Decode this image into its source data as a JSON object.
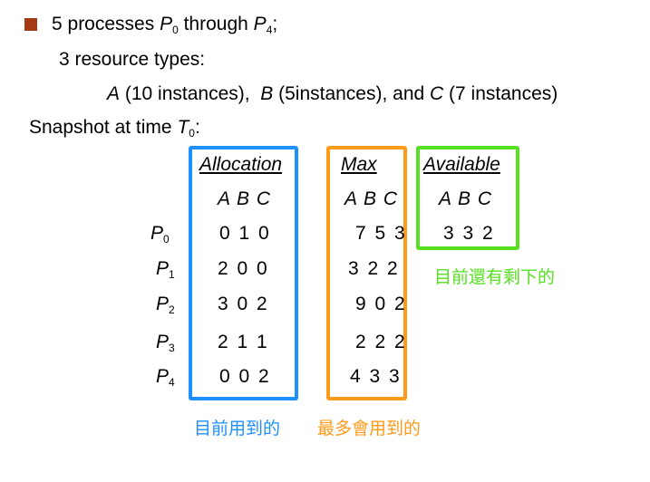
{
  "colors": {
    "bullet": "#a33a13",
    "allocation": "#1e90ff",
    "max": "#ff9a1a",
    "available": "#55e020"
  },
  "line1": {
    "prefix": "5 processes ",
    "p_start": "P",
    "p_start_sub": "0",
    "middle": " through ",
    "p_end": "P",
    "p_end_sub": "4",
    "suffix": ";"
  },
  "line2": "3 resource types:",
  "line3": {
    "a_name": "A",
    "a_text": " (10 instances),  ",
    "b_name": "B",
    "b_text": " (5instances), and ",
    "c_name": "C",
    "c_text": " (7 instances)"
  },
  "snapshot": {
    "text": "Snapshot at time ",
    "t_name": "T",
    "t_sub": "0",
    "colon": ":"
  },
  "headers": {
    "allocation": "Allocation",
    "max": "Max",
    "available": "Available"
  },
  "column_letters": "A B C",
  "processes": [
    {
      "name": "P",
      "sub": "0",
      "allocation": "0 1 0",
      "max": "7 5 3"
    },
    {
      "name": "P",
      "sub": "1",
      "allocation": "2 0 0",
      "max": "3 2 2"
    },
    {
      "name": "P",
      "sub": "2",
      "allocation": "3 0 2",
      "max": "9 0 2"
    },
    {
      "name": "P",
      "sub": "3",
      "allocation": "2 1 1",
      "max": "2 2 2"
    },
    {
      "name": "P",
      "sub": "4",
      "allocation": "0 0 2",
      "max": "4 3 3"
    }
  ],
  "available_values": "3 3 2",
  "notes": {
    "available": "目前還有剩下的",
    "allocation": "目前用到的",
    "max": "最多會用到的"
  }
}
